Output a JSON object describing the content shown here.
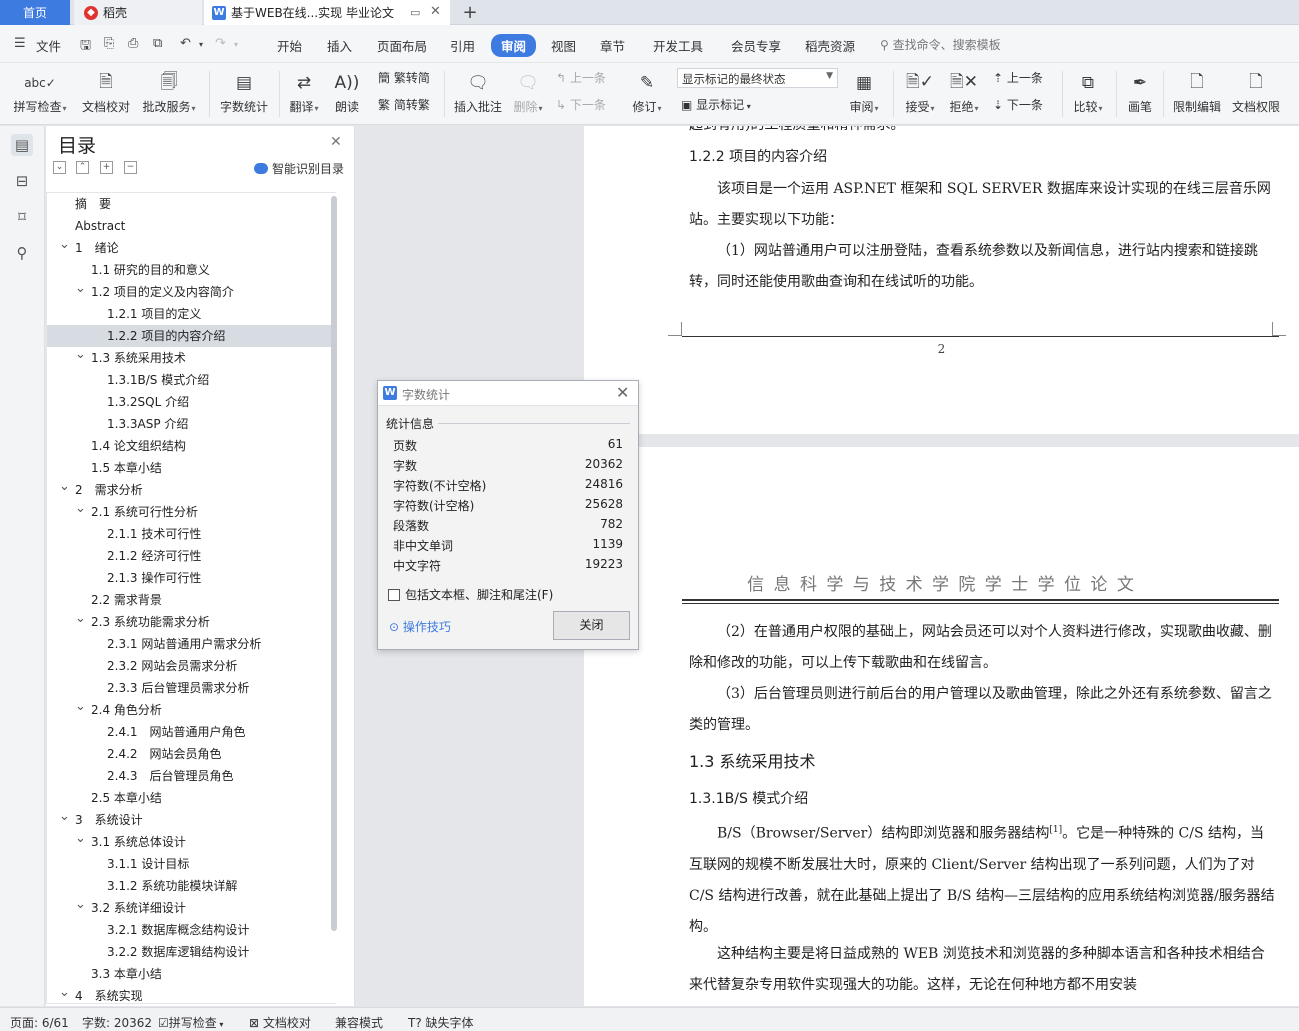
{
  "tabs": {
    "home": "首页",
    "daoke": "稻壳",
    "document": "基于WEB在线...实现 毕业论文"
  },
  "ribbon_tabs": [
    "文件",
    "开始",
    "插入",
    "页面布局",
    "引用",
    "审阅",
    "视图",
    "章节",
    "开发工具",
    "会员专享",
    "稻壳资源"
  ],
  "active_ribbon_tab": "审阅",
  "search_commands": "查找命令、搜索模板",
  "ribbon": {
    "spellcheck": "拼写检查",
    "doc_check": "文档校对",
    "annotate_service": "批改服务",
    "word_count": "字数统计",
    "translate": "翻译",
    "read_aloud": "朗读",
    "trad_to_simp": "繁转简",
    "simp_to_trad": "简转繁",
    "insert_comment": "插入批注",
    "delete": "删除",
    "prev_comment": "上一条",
    "next_comment": "下一条",
    "revise": "修订",
    "markup_state": "显示标记的最终状态",
    "show_markup": "显示标记",
    "review": "审阅",
    "accept": "接受",
    "reject": "拒绝",
    "prev_change": "上一条",
    "next_change": "下一条",
    "compare": "比较",
    "ink": "画笔",
    "restrict_edit": "限制编辑",
    "doc_permission": "文档权限"
  },
  "toc": {
    "title": "目录",
    "smart_button": "智能识别目录",
    "items": [
      {
        "text": "摘　要",
        "level": 0
      },
      {
        "text": "Abstract",
        "level": 0
      },
      {
        "text": "1　绪论",
        "level": 0,
        "toggle": true
      },
      {
        "text": "1.1 研究的目的和意义",
        "level": 1
      },
      {
        "text": "1.2 项目的定义及内容简介",
        "level": 1,
        "toggle": true
      },
      {
        "text": "1.2.1 项目的定义",
        "level": 2
      },
      {
        "text": "1.2.2 项目的内容介绍",
        "level": 2,
        "selected": true
      },
      {
        "text": "1.3 系统采用技术",
        "level": 1,
        "toggle": true
      },
      {
        "text": "1.3.1B/S 模式介绍",
        "level": 2
      },
      {
        "text": "1.3.2SQL 介绍",
        "level": 2
      },
      {
        "text": "1.3.3ASP 介绍",
        "level": 2
      },
      {
        "text": "1.4 论文组织结构",
        "level": 1
      },
      {
        "text": "1.5 本章小结",
        "level": 1
      },
      {
        "text": "2　需求分析",
        "level": 0,
        "toggle": true
      },
      {
        "text": "2.1 系统可行性分析",
        "level": 1,
        "toggle": true
      },
      {
        "text": "2.1.1 技术可行性",
        "level": 2
      },
      {
        "text": "2.1.2 经济可行性",
        "level": 2
      },
      {
        "text": "2.1.3 操作可行性",
        "level": 2
      },
      {
        "text": "2.2 需求背景",
        "level": 1
      },
      {
        "text": "2.3 系统功能需求分析",
        "level": 1,
        "toggle": true
      },
      {
        "text": "2.3.1 网站普通用户需求分析",
        "level": 2
      },
      {
        "text": "2.3.2 网站会员需求分析",
        "level": 2
      },
      {
        "text": "2.3.3 后台管理员需求分析",
        "level": 2
      },
      {
        "text": "2.4 角色分析",
        "level": 1,
        "toggle": true
      },
      {
        "text": "2.4.1　网站普通用户角色",
        "level": 2
      },
      {
        "text": "2.4.2　网站会员角色",
        "level": 2
      },
      {
        "text": "2.4.3　后台管理员角色",
        "level": 2
      },
      {
        "text": "2.5 本章小结",
        "level": 1
      },
      {
        "text": "3　系统设计",
        "level": 0,
        "toggle": true
      },
      {
        "text": "3.1 系统总体设计",
        "level": 1,
        "toggle": true
      },
      {
        "text": "3.1.1 设计目标",
        "level": 2
      },
      {
        "text": "3.1.2 系统功能模块详解",
        "level": 2
      },
      {
        "text": "3.2 系统详细设计",
        "level": 1,
        "toggle": true
      },
      {
        "text": "3.2.1 数据库概念结构设计",
        "level": 2
      },
      {
        "text": "3.2.2 数据库逻辑结构设计",
        "level": 2
      },
      {
        "text": "3.3 本章小结",
        "level": 1
      },
      {
        "text": "4　系统实现",
        "level": 0,
        "toggle": true
      }
    ]
  },
  "page1": {
    "top_cut": "起到有用)的工程质量和精神需求。",
    "heading": "1.2.2 项目的内容介绍",
    "para1": "该项目是一个运用 ASP.NET 框架和 SQL SERVER 数据库来设计实现的在线三层音乐网站。主要实现以下功能：",
    "para2": "（1）网站普通用户可以注册登陆，查看系统参数以及新闻信息，进行站内搜索和链接跳转，同时还能使用歌曲查询和在线试听的功能。",
    "page_number": "2"
  },
  "page2": {
    "header": "信 息 科 学 与 技 术 学 院 学 士 学 位 论 文",
    "para1": "（2）在普通用户权限的基础上，网站会员还可以对个人资料进行修改，实现歌曲收藏、删除和修改的功能，可以上传下载歌曲和在线留言。",
    "para2": "（3）后台管理员则进行前后台的用户管理以及歌曲管理，除此之外还有系统参数、留言之类的管理。",
    "heading1": "1.3 系统采用技术",
    "heading2": "1.3.1B/S 模式介绍",
    "para3a": "B/S（Browser/Server）结构即浏览器和服务器结构",
    "para3_ref": "[1]",
    "para3b": "。它是一种特殊的 C/S 结构，当互联网的规模不断发展壮大时，原来的 Client/Server 结构出现了一系列问题，人们为了对 C/S 结构进行改善，就在此基础上提出了 B/S 结构—三层结构的应用系统结构浏览器/服务器结构。",
    "para4": "这种结构主要是将日益成熟的 WEB 浏览技术和浏览器的多种脚本语言和各种技术相结合来代替复杂专用软件实现强大的功能。这样，无论在何种地方都不用安装"
  },
  "dialog": {
    "title": "字数统计",
    "section": "统计信息",
    "rows": [
      {
        "label": "页数",
        "value": "61"
      },
      {
        "label": "字数",
        "value": "20362"
      },
      {
        "label": "字符数(不计空格)",
        "value": "24816"
      },
      {
        "label": "字符数(计空格)",
        "value": "25628"
      },
      {
        "label": "段落数",
        "value": "782"
      },
      {
        "label": "非中文单词",
        "value": "1139"
      },
      {
        "label": "中文字符",
        "value": "19223"
      }
    ],
    "checkbox": "包括文本框、脚注和尾注(F)",
    "tips": "操作技巧",
    "close": "关闭"
  },
  "status": {
    "page": "页面: 6/61",
    "words": "字数: 20362",
    "spellcheck": "拼写检查",
    "doc_check": "文档校对",
    "compat": "兼容模式",
    "missing_font": "缺失字体"
  }
}
